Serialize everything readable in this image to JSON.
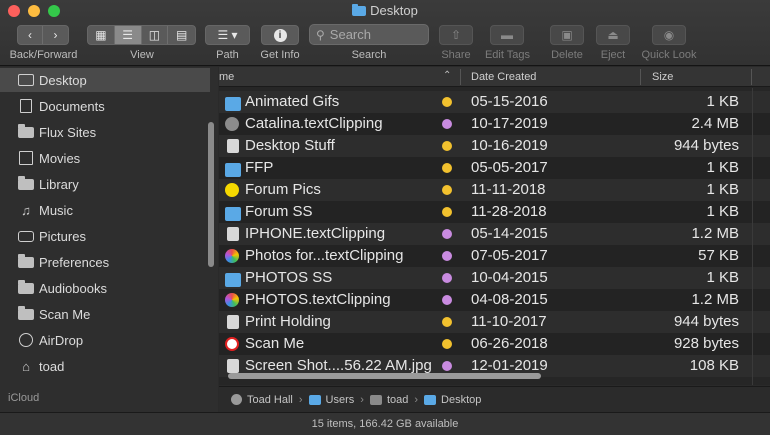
{
  "window": {
    "title": "Desktop"
  },
  "toolbar": {
    "back_forward_label": "Back/Forward",
    "view_label": "View",
    "path_label": "Path",
    "get_info_label": "Get Info",
    "search_label": "Search",
    "search_placeholder": "Search",
    "share_label": "Share",
    "edit_tags_label": "Edit Tags",
    "delete_label": "Delete",
    "eject_label": "Eject",
    "quick_look_label": "Quick Look"
  },
  "sidebar": {
    "items": [
      {
        "label": "Desktop",
        "icon": "desktop-icon",
        "selected": true
      },
      {
        "label": "Documents",
        "icon": "document-icon"
      },
      {
        "label": "Flux Sites",
        "icon": "folder-icon"
      },
      {
        "label": "Movies",
        "icon": "film-icon"
      },
      {
        "label": "Library",
        "icon": "folder-icon"
      },
      {
        "label": "Music",
        "icon": "music-icon"
      },
      {
        "label": "Pictures",
        "icon": "camera-icon"
      },
      {
        "label": "Preferences",
        "icon": "folder-icon"
      },
      {
        "label": "Audiobooks",
        "icon": "folder-icon"
      },
      {
        "label": "Scan Me",
        "icon": "folder-icon"
      },
      {
        "label": "AirDrop",
        "icon": "airdrop-icon"
      },
      {
        "label": "toad",
        "icon": "home-icon"
      }
    ],
    "section_icloud": "iCloud"
  },
  "columns": {
    "name": "me",
    "date": "Date Created",
    "size": "Size"
  },
  "files": [
    {
      "name": "Animated Gifs",
      "date": "05-15-2016",
      "size": "1 KB",
      "tag": "#f2c12e",
      "icon": "folder"
    },
    {
      "name": "Catalina.textClipping",
      "date": "10-17-2019",
      "size": "2.4 MB",
      "tag": "#c98be0",
      "icon": "dot"
    },
    {
      "name": "Desktop Stuff",
      "date": "10-16-2019",
      "size": "944 bytes",
      "tag": "#f2c12e",
      "icon": "clip"
    },
    {
      "name": "FFP",
      "date": "05-05-2017",
      "size": "1 KB",
      "tag": "#f2c12e",
      "icon": "folder"
    },
    {
      "name": "Forum Pics",
      "date": "11-11-2018",
      "size": "1 KB",
      "tag": "#f2c12e",
      "icon": "dot-yellow"
    },
    {
      "name": "Forum SS",
      "date": "11-28-2018",
      "size": "1 KB",
      "tag": "#f2c12e",
      "icon": "folder"
    },
    {
      "name": "IPHONE.textClipping",
      "date": "05-14-2015",
      "size": "1.2 MB",
      "tag": "#c98be0",
      "icon": "clip"
    },
    {
      "name": "Photos for...textClipping",
      "date": "07-05-2017",
      "size": "57 KB",
      "tag": "#c98be0",
      "icon": "dot-color"
    },
    {
      "name": "PHOTOS SS",
      "date": "10-04-2015",
      "size": "1 KB",
      "tag": "#c98be0",
      "icon": "folder"
    },
    {
      "name": "PHOTOS.textClipping",
      "date": "04-08-2015",
      "size": "1.2 MB",
      "tag": "#c98be0",
      "icon": "dot-color"
    },
    {
      "name": "Print Holding",
      "date": "11-10-2017",
      "size": "944 bytes",
      "tag": "#f2c12e",
      "icon": "clip"
    },
    {
      "name": "Scan Me",
      "date": "06-26-2018",
      "size": "928 bytes",
      "tag": "#f2c12e",
      "icon": "dot-red"
    },
    {
      "name": "Screen Shot....56.22 AM.jpg",
      "date": "12-01-2019",
      "size": "108 KB",
      "tag": "#c98be0",
      "icon": "clip"
    }
  ],
  "pathbar": [
    "Toad Hall",
    "Users",
    "toad",
    "Desktop"
  ],
  "status": "15 items, 166.42 GB available"
}
